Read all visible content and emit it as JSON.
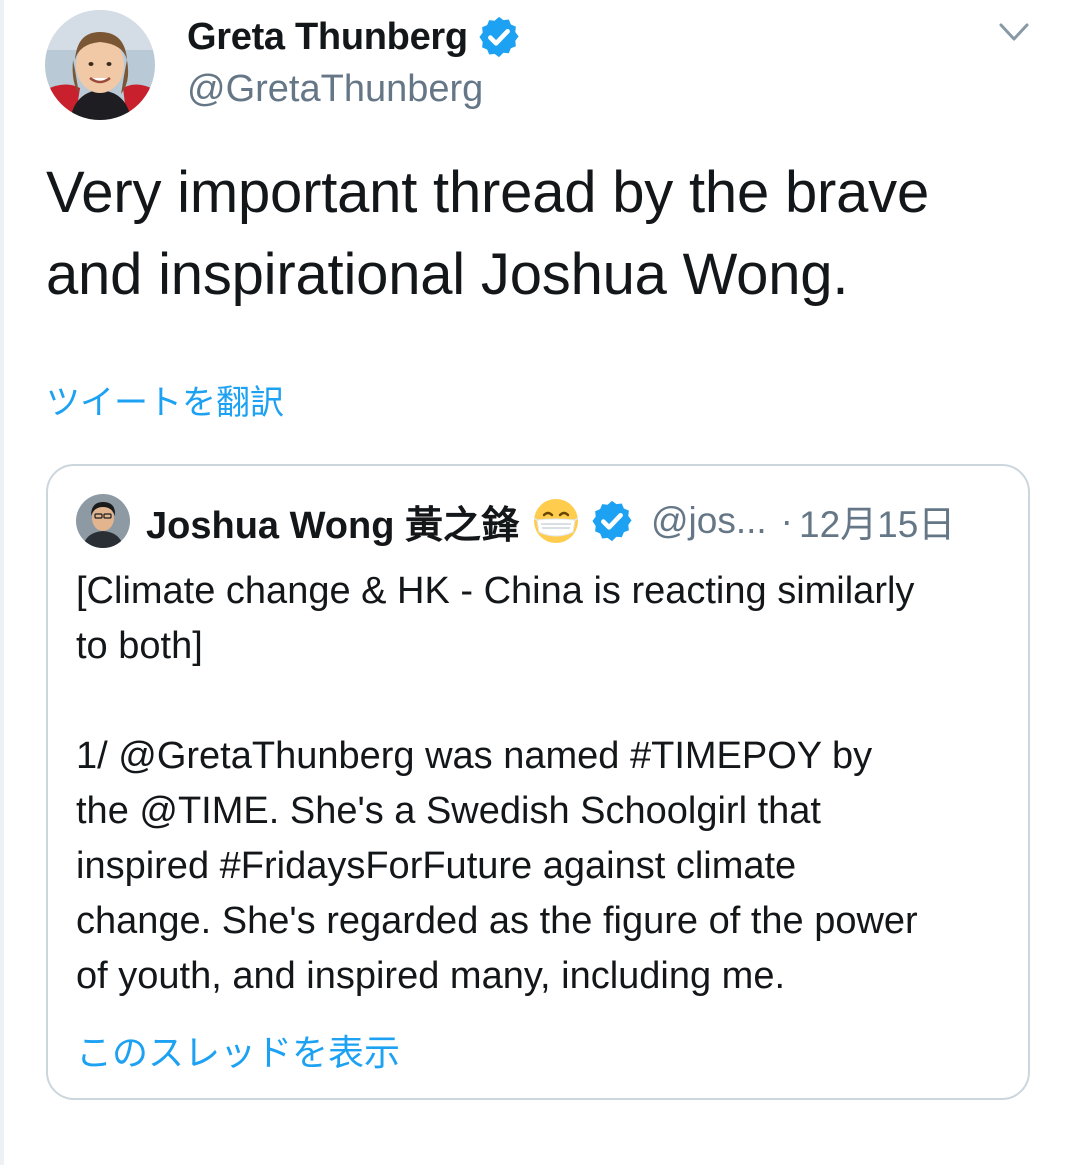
{
  "tweet": {
    "author": {
      "display_name": "Greta Thunberg",
      "handle": "@GretaThunberg",
      "verified": true,
      "avatar_icon": "user-avatar-photo"
    },
    "menu_icon": "chevron-down-icon",
    "text_lines": [
      "Very important thread by the brave",
      "and inspirational Joshua Wong."
    ],
    "translate_label": "ツイートを翻訳"
  },
  "quoted_tweet": {
    "author": {
      "display_name": "Joshua Wong 黃之鋒",
      "emoji_icon": "face-with-medical-mask-emoji",
      "verified": true,
      "handle": "@jos...",
      "avatar_icon": "user-avatar-photo"
    },
    "separator": "·",
    "date": "12月15日",
    "body_lines_1": [
      "[Climate change & HK - China is reacting similarly",
      "to both]"
    ],
    "body_lines_2": [
      "1/ @GretaThunberg was named #TIMEPOY by",
      "the @TIME. She's a Swedish Schoolgirl that",
      "inspired #FridaysForFuture against climate",
      "change. She's regarded as the figure of the power",
      "of youth, and inspired many, including me."
    ],
    "show_thread_label": "このスレッドを表示"
  },
  "colors": {
    "link_blue": "#1da1f2",
    "verified_blue": "#1da1f2",
    "text_primary": "#14171a",
    "text_secondary": "#657786",
    "card_border": "#ccd6dd"
  }
}
